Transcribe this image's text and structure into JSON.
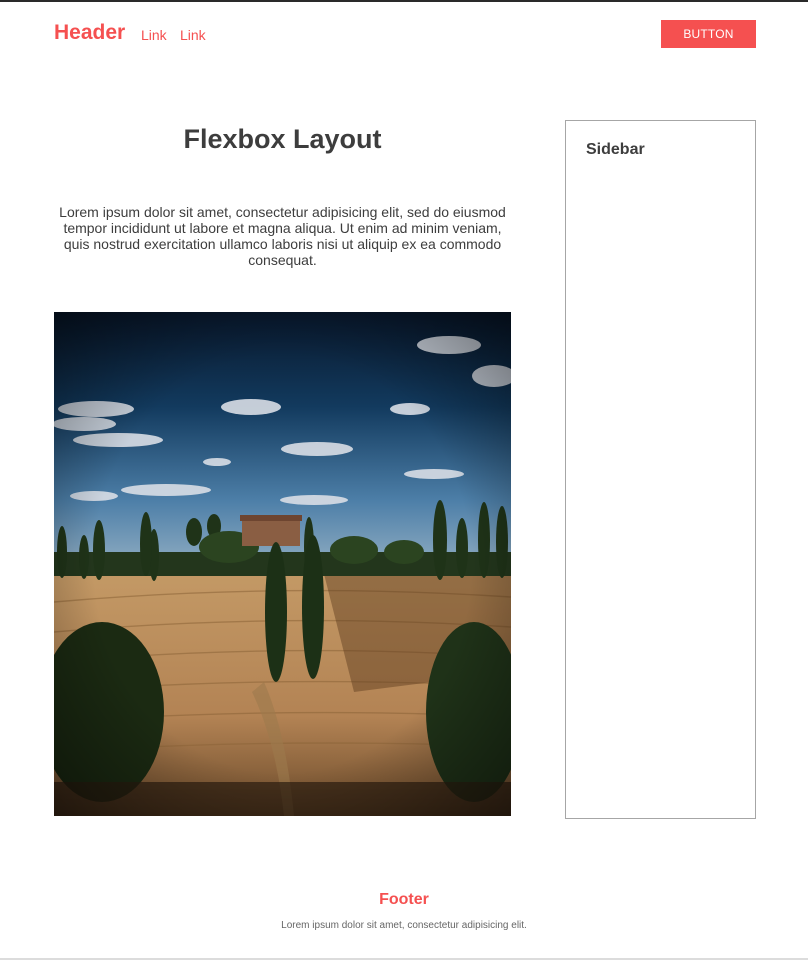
{
  "header": {
    "brand": "Header",
    "links": [
      "Link",
      "Link"
    ],
    "button_label": "BUTTON"
  },
  "main": {
    "title": "Flexbox Layout",
    "intro": "Lorem ipsum dolor sit amet, consectetur adipisicing elit, sed do eiusmod tempor incididunt ut labore et magna aliqua. Ut enim ad minim veniam, quis nostrud exercitation ullamco laboris nisi ut aliquip ex ea commodo consequat.",
    "image_subject": "tuscan-landscape-photo"
  },
  "sidebar": {
    "title": "Sidebar"
  },
  "footer": {
    "title": "Footer",
    "text": "Lorem ipsum dolor sit amet, consectetur adipisicing elit."
  },
  "colors": {
    "accent": "#f55050",
    "text": "#3d3d3d",
    "border": "#a6a6a6"
  }
}
